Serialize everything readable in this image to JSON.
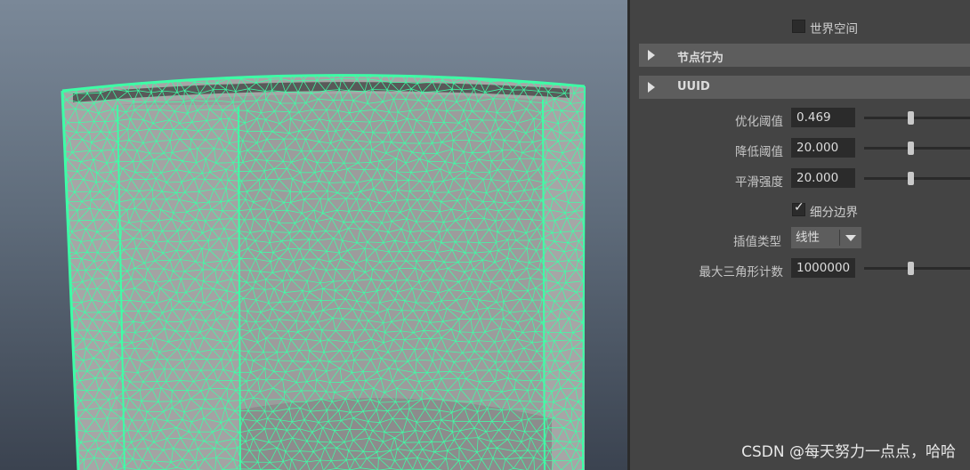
{
  "attribute_editor": {
    "world_space": {
      "label": "世界空间",
      "checked": false
    },
    "sections": [
      {
        "title": "节点行为",
        "expanded": false
      },
      {
        "title": "UUID",
        "expanded": false
      }
    ],
    "attributes": [
      {
        "label": "优化阈值",
        "value": "0.469",
        "slider_fraction": 0.5
      },
      {
        "label": "降低阈值",
        "value": "20.000",
        "slider_fraction": 0.5
      },
      {
        "label": "平滑强度",
        "value": "20.000",
        "slider_fraction": 0.5
      }
    ],
    "subdivide_border": {
      "label": "细分边界",
      "checked": true
    },
    "interpolation_type": {
      "label": "插值类型",
      "value": "线性"
    },
    "max_triangle_count": {
      "label": "最大三角形计数",
      "value": "1000000",
      "slider_fraction": 0.5
    }
  },
  "viewport": {
    "wireframe_color": "#3dffa6",
    "surface_color": "#a8a8a8"
  },
  "watermark": "CSDN @每天努力一点点，哈哈"
}
